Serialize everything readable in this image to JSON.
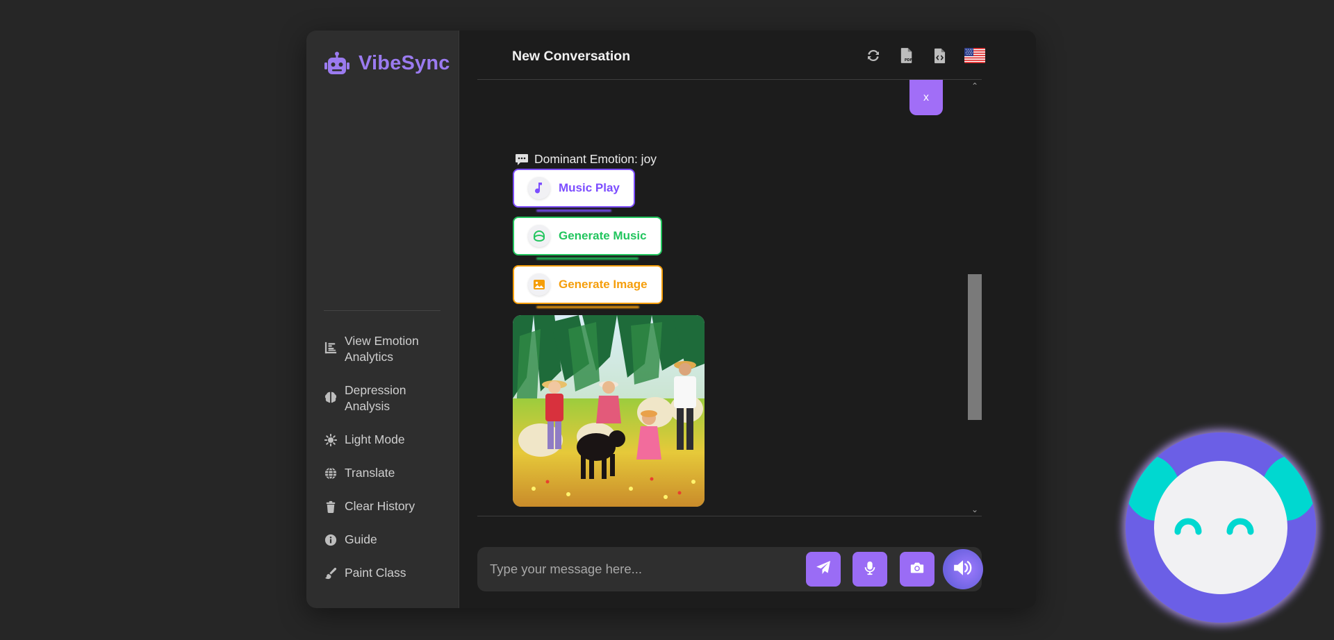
{
  "app": {
    "name": "VibeSync",
    "accent": "#9b7bf0"
  },
  "sidebar": {
    "items": [
      {
        "label_line1": "View Emotion",
        "label_line2": "Analytics",
        "icon": "chart-icon"
      },
      {
        "label_line1": "Depression",
        "label_line2": "Analysis",
        "icon": "brain-icon"
      },
      {
        "label": "Light Mode",
        "icon": "sun-icon"
      },
      {
        "label": "Translate",
        "icon": "globe-icon"
      },
      {
        "label": "Clear History",
        "icon": "trash-icon"
      },
      {
        "label": "Guide",
        "icon": "info-icon"
      },
      {
        "label": "Paint Class",
        "icon": "brush-icon"
      }
    ]
  },
  "header": {
    "title": "New Conversation",
    "icons": [
      "refresh-icon",
      "pdf-file-icon",
      "code-file-icon",
      "us-flag-icon"
    ]
  },
  "chat": {
    "user_message": "x",
    "emotion_text": "Dominant Emotion: joy",
    "actions": {
      "music_play": "Music Play",
      "generate_music": "Generate Music",
      "generate_image": "Generate Image"
    },
    "scroll": {
      "up_glyph": "⌃",
      "down_glyph": "⌄"
    }
  },
  "input": {
    "placeholder": "Type your message here...",
    "value": ""
  },
  "colors": {
    "music": "#7c4dff",
    "generate_music": "#22c55e",
    "generate_image": "#f59e0b",
    "send_buttons": "#9a6cf5",
    "mascot_body": "#6b5fe6",
    "mascot_ears": "#00d8d0"
  }
}
